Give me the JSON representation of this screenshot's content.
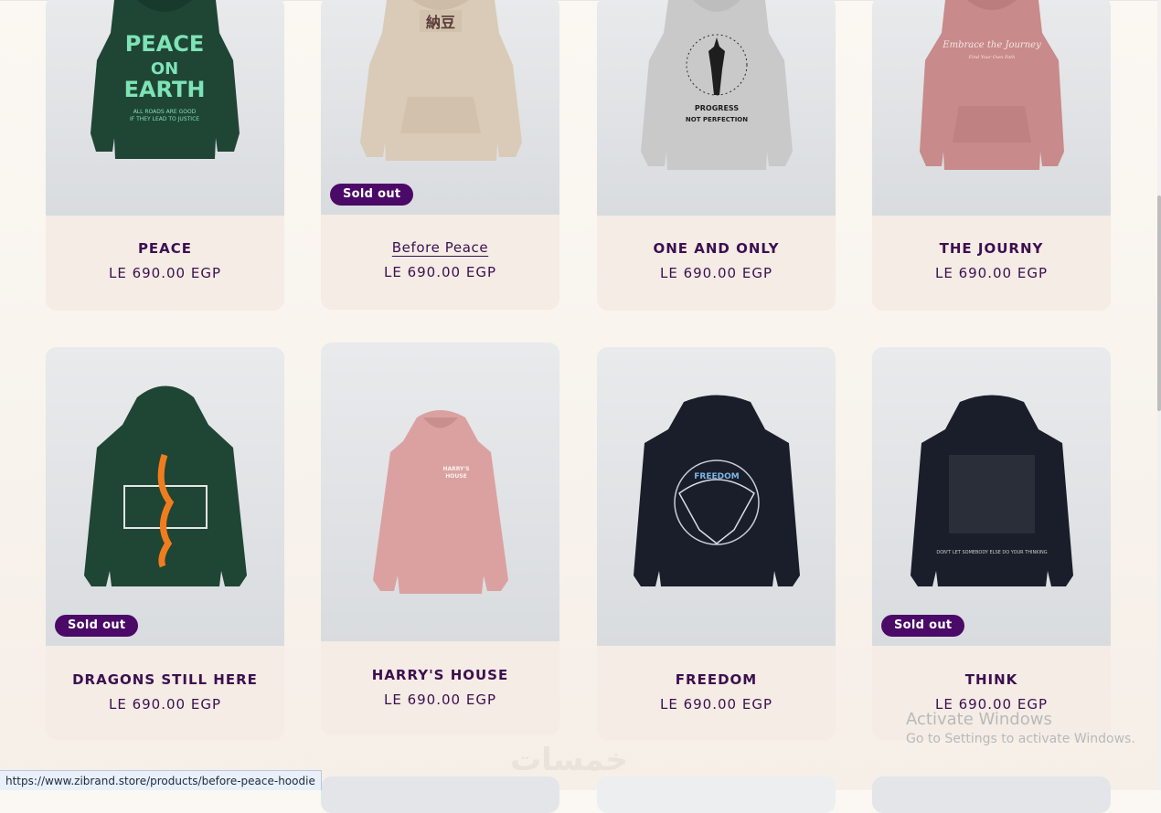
{
  "products": [
    {
      "title": "PEACE",
      "price": "LE 690.00 EGP",
      "sold_out": false,
      "color": "#1f4535",
      "print": "PEACE ON EARTH"
    },
    {
      "title": "Before Peace",
      "price": "LE 690.00 EGP",
      "sold_out": true,
      "color": "#d9cbb8",
      "print": "納豆"
    },
    {
      "title": "ONE AND ONLY",
      "price": "LE 690.00 EGP",
      "sold_out": false,
      "color": "#c9c9c9",
      "print": "PROGRESS NOT PERFECTION"
    },
    {
      "title": "THE JOURNY",
      "price": "LE 690.00 EGP",
      "sold_out": false,
      "color": "#c88a8a",
      "print": "Embrace the Journey"
    },
    {
      "title": "DRAGONS STILL HERE",
      "price": "LE 690.00 EGP",
      "sold_out": true,
      "color": "#1f4535",
      "print": ""
    },
    {
      "title": "HARRY'S HOUSE",
      "price": "LE 690.00 EGP",
      "sold_out": false,
      "color": "#dba1a1",
      "print": "HARRY'S HOUSE"
    },
    {
      "title": "FREEDOM",
      "price": "LE 690.00 EGP",
      "sold_out": false,
      "color": "#1a1e2a",
      "print": ""
    },
    {
      "title": "THINK",
      "price": "LE 690.00 EGP",
      "sold_out": true,
      "color": "#1a1e2a",
      "print": ""
    }
  ],
  "badge_label": "Sold out",
  "windows_watermark": {
    "line1": "Activate Windows",
    "line2": "Go to Settings to activate Windows."
  },
  "site_watermark": "خمسات",
  "status_url": "https://www.zibrand.store/products/before-peace-hoodie",
  "colors": {
    "accent": "#4b0a67",
    "text": "#3d0f4f",
    "card_bg": "#f4ece5"
  }
}
